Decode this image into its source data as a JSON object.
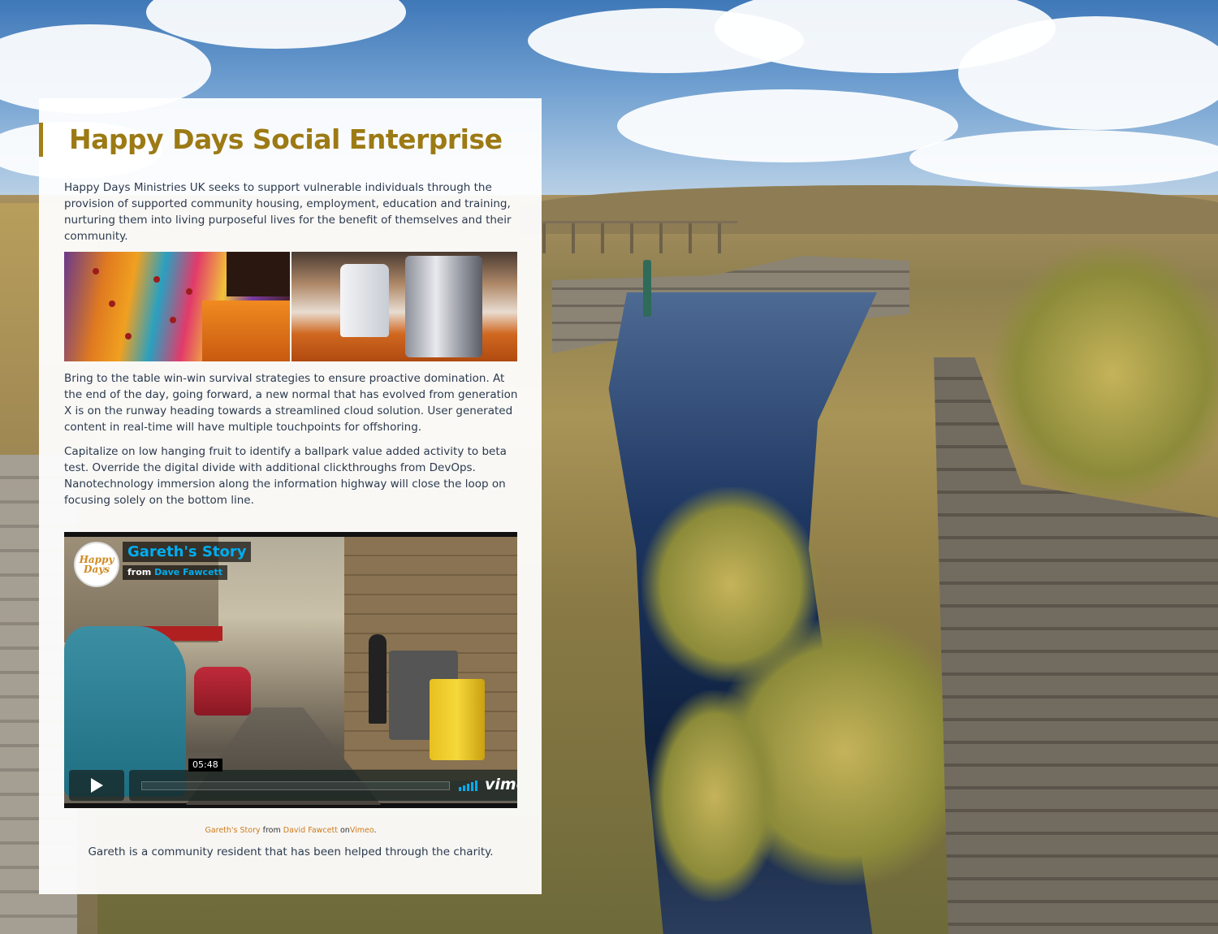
{
  "page": {
    "title": "Happy Days Social Enterprise",
    "intro": "Happy Days Ministries UK seeks to support vulnerable individuals through the provision of supported community housing, employment, education and training, nurturing them into living purposeful lives for the benefit of themselves and their community.",
    "paragraph_2": "Bring to the table win-win survival strategies to ensure proactive domination. At the end of the day, going forward, a new normal that has evolved from generation X is on the runway heading towards a streamlined cloud solution. User generated content in real-time will have multiple touchpoints for offshoring.",
    "paragraph_3": "Capitalize on low hanging fruit to identify a ballpark value added activity to beta test. Override the digital divide with additional clickthroughs from DevOps. Nanotechnology immersion along the information highway will close the loop on focusing solely on the bottom line.",
    "caption": "Gareth is a community resident that has been helped through the charity."
  },
  "gallery": [
    {
      "name": "colourful-sofa-photo"
    },
    {
      "name": "coffee-machine-photo"
    }
  ],
  "video": {
    "title": "Gareth's Story",
    "from_label": "from",
    "author": "Dave Fawcett",
    "logo_text": "Happy Days",
    "duration": "05:48",
    "brand": "vimeo",
    "progress": 0
  },
  "credit": {
    "video_link": "Gareth's Story",
    "from_word": "from",
    "author_link": "David Fawcett",
    "on_word": "on",
    "platform_link": "Vimeo",
    "period": "."
  },
  "colors": {
    "title": "#9c7a14",
    "accent_bar": "#a37f18",
    "link": "#d07b1c",
    "vimeo_blue": "#00adef",
    "body_text": "#2b3a4f"
  }
}
